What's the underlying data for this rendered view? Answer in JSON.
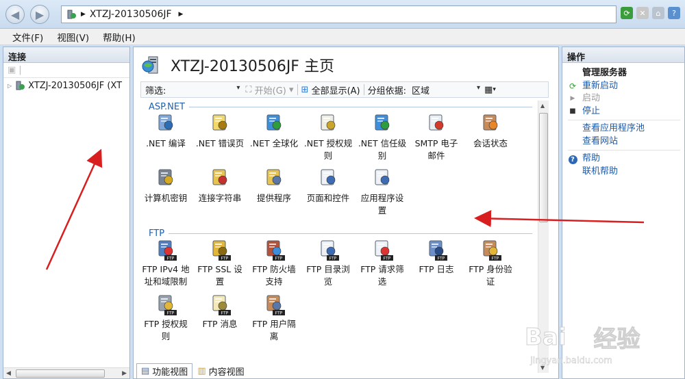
{
  "address": {
    "path": "XTZJ-20130506JF"
  },
  "menu": [
    "文件(F)",
    "视图(V)",
    "帮助(H)"
  ],
  "connections": {
    "title": "连接",
    "server": "XTZJ-20130506JF (XT"
  },
  "center": {
    "title": "XTZJ-20130506JF 主页",
    "filter_label": "筛选:",
    "start_label": "开始(G)",
    "show_all_label": "全部显示(A)",
    "group_by_label": "分组依据:",
    "group_by_value": "区域"
  },
  "groups": {
    "aspnet": {
      "name": "ASP.NET",
      "items": [
        {
          "line1": ".NET 编译",
          "line2": "",
          "icon": "net-compile-icon"
        },
        {
          "line1": ".NET 错误页",
          "line2": "",
          "icon": "net-error-pages-icon"
        },
        {
          "line1": ".NET 全球化",
          "line2": "",
          "icon": "net-globalization-icon"
        },
        {
          "line1": ".NET 授权规",
          "line2": "则",
          "icon": "net-authorization-icon"
        },
        {
          "line1": ".NET 信任级",
          "line2": "别",
          "icon": "net-trust-icon"
        },
        {
          "line1": "SMTP 电子",
          "line2": "邮件",
          "icon": "smtp-mail-icon"
        },
        {
          "line1": "会话状态",
          "line2": "",
          "icon": "session-state-icon"
        },
        {
          "line1": "计算机密钥",
          "line2": "",
          "icon": "machine-key-icon"
        },
        {
          "line1": "连接字符串",
          "line2": "",
          "icon": "connection-strings-icon"
        },
        {
          "line1": "提供程序",
          "line2": "",
          "icon": "providers-icon"
        },
        {
          "line1": "页面和控件",
          "line2": "",
          "icon": "pages-controls-icon"
        },
        {
          "line1": "应用程序设",
          "line2": "置",
          "icon": "app-settings-icon"
        }
      ]
    },
    "ftp": {
      "name": "FTP",
      "items": [
        {
          "line1": "FTP IPv4 地",
          "line2": "址和域限制",
          "icon": "ftp-ipv4-icon"
        },
        {
          "line1": "FTP SSL 设",
          "line2": "置",
          "icon": "ftp-ssl-icon"
        },
        {
          "line1": "FTP 防火墙",
          "line2": "支持",
          "icon": "ftp-firewall-icon"
        },
        {
          "line1": "FTP 目录浏",
          "line2": "览",
          "icon": "ftp-directory-browsing-icon"
        },
        {
          "line1": "FTP 请求筛",
          "line2": "选",
          "icon": "ftp-request-filtering-icon"
        },
        {
          "line1": "FTP 日志",
          "line2": "",
          "icon": "ftp-logging-icon"
        },
        {
          "line1": "FTP 身份验",
          "line2": "证",
          "icon": "ftp-authentication-icon"
        },
        {
          "line1": "FTP 授权规",
          "line2": "则",
          "icon": "ftp-authorization-icon"
        },
        {
          "line1": "FTP 消息",
          "line2": "",
          "icon": "ftp-messages-icon"
        },
        {
          "line1": "FTP 用户隔",
          "line2": "离",
          "icon": "ftp-user-isolation-icon"
        }
      ]
    }
  },
  "view_tabs": {
    "features": "功能视图",
    "content": "内容视图"
  },
  "actions": {
    "title": "操作",
    "manage_server": "管理服务器",
    "restart": "重新启动",
    "start": "启动",
    "stop": "停止",
    "view_pools": "查看应用程序池",
    "view_sites": "查看网站",
    "help": "帮助",
    "online_help": "联机帮助"
  },
  "watermark": {
    "brand": "Bai",
    "brand_cn": "经验",
    "url": "jingyan.baidu.com"
  },
  "colors": {
    "link": "#1d5aa8",
    "group_header": "#1f5fb0",
    "arrow": "#d81e1e"
  }
}
